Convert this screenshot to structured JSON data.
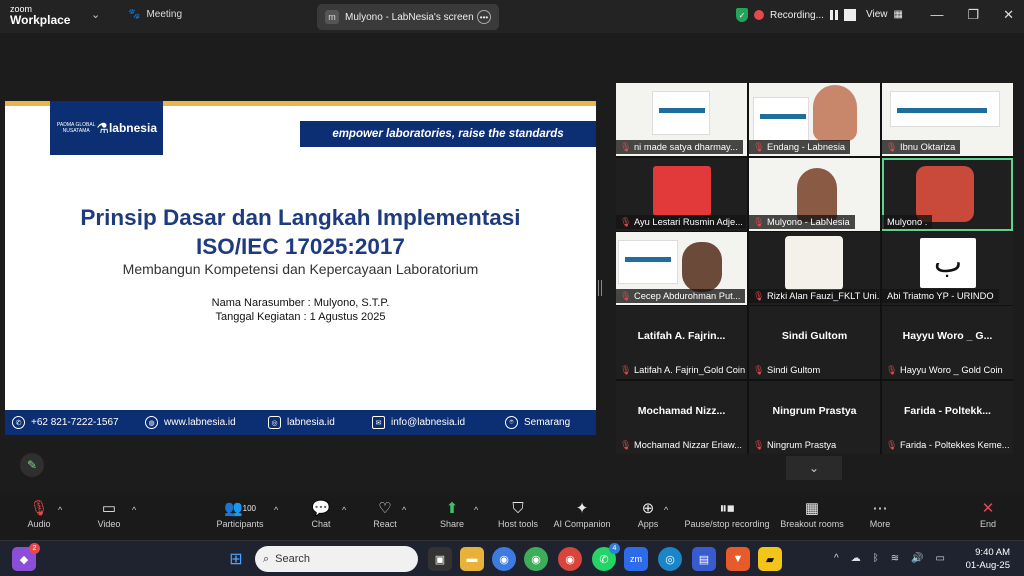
{
  "topbar": {
    "logo_top": "zoom",
    "logo_bottom": "Workplace",
    "meeting": "Meeting",
    "share_tab": "Mulyono - LabNesia's screen",
    "share_tab_initial": "m",
    "recording": "Recording...",
    "view": "View"
  },
  "slide": {
    "logo_left_text": "PADMA GLOBAL NUSATAMA",
    "logo_right_text": "labnesia",
    "tagline": "empower laboratories, raise the standards",
    "title_line1": "Prinsip Dasar dan Langkah Implementasi",
    "title_line2": "ISO/IEC 17025:2017",
    "subtitle": "Membangun Kompetensi dan Kepercayaan Laboratorium",
    "speaker": "Nama Narasumber : Mulyono, S.T.P.",
    "date": "Tanggal Kegiatan : 1 Agustus 2025",
    "phone": "+62 821-7222-1567",
    "website": "www.labnesia.id",
    "instagram": "labnesia.id",
    "email": "info@labnesia.id",
    "city": "Semarang"
  },
  "participants": [
    {
      "name": "ni made satya dharmay...",
      "muted": true
    },
    {
      "name": "Endang - Labnesia",
      "muted": true
    },
    {
      "name": "Ibnu Oktariza",
      "muted": true
    },
    {
      "name": "Ayu Lestari Rusmin Adje...",
      "muted": true
    },
    {
      "name": "Mulyono - LabNesia",
      "muted": true
    },
    {
      "name": "Mulyono .",
      "muted": false
    },
    {
      "name": "Cecep Abdurohman Put...",
      "muted": true
    },
    {
      "name": "Rizki Alan Fauzi_FKLT Uni...",
      "muted": true
    },
    {
      "name": "Abi Triatmo YP - URINDO",
      "muted": false
    },
    {
      "name": "Latifah A. Fajrin_Gold Coin",
      "big": "Latifah A. Fajrin...",
      "muted": true
    },
    {
      "name": "Sindi Gultom",
      "big": "Sindi Gultom",
      "muted": true
    },
    {
      "name": "Hayyu Woro _ Gold Coin",
      "big": "Hayyu Woro _ G...",
      "muted": true
    },
    {
      "name": "Mochamad Nizzar Eriaw...",
      "big": "Mochamad  Nizz...",
      "muted": true
    },
    {
      "name": "Ningrum Prastya",
      "big": "Ningrum Prastya",
      "muted": true
    },
    {
      "name": "Farida - Poltekkes Keme...",
      "big": "Farida  - Poltekk...",
      "muted": true
    }
  ],
  "toolbar": {
    "audio": "Audio",
    "video": "Video",
    "participants": "Participants",
    "participants_count": "100",
    "chat": "Chat",
    "react": "React",
    "share": "Share",
    "host_tools": "Host tools",
    "ai_companion": "AI Companion",
    "apps": "Apps",
    "pause_stop": "Pause/stop recording",
    "breakout": "Breakout rooms",
    "more": "More",
    "end": "End"
  },
  "taskbar": {
    "search_placeholder": "Search",
    "time": "9:40 AM",
    "date": "01-Aug-25",
    "badge_chat": "2",
    "badge_whatsapp": "4"
  }
}
